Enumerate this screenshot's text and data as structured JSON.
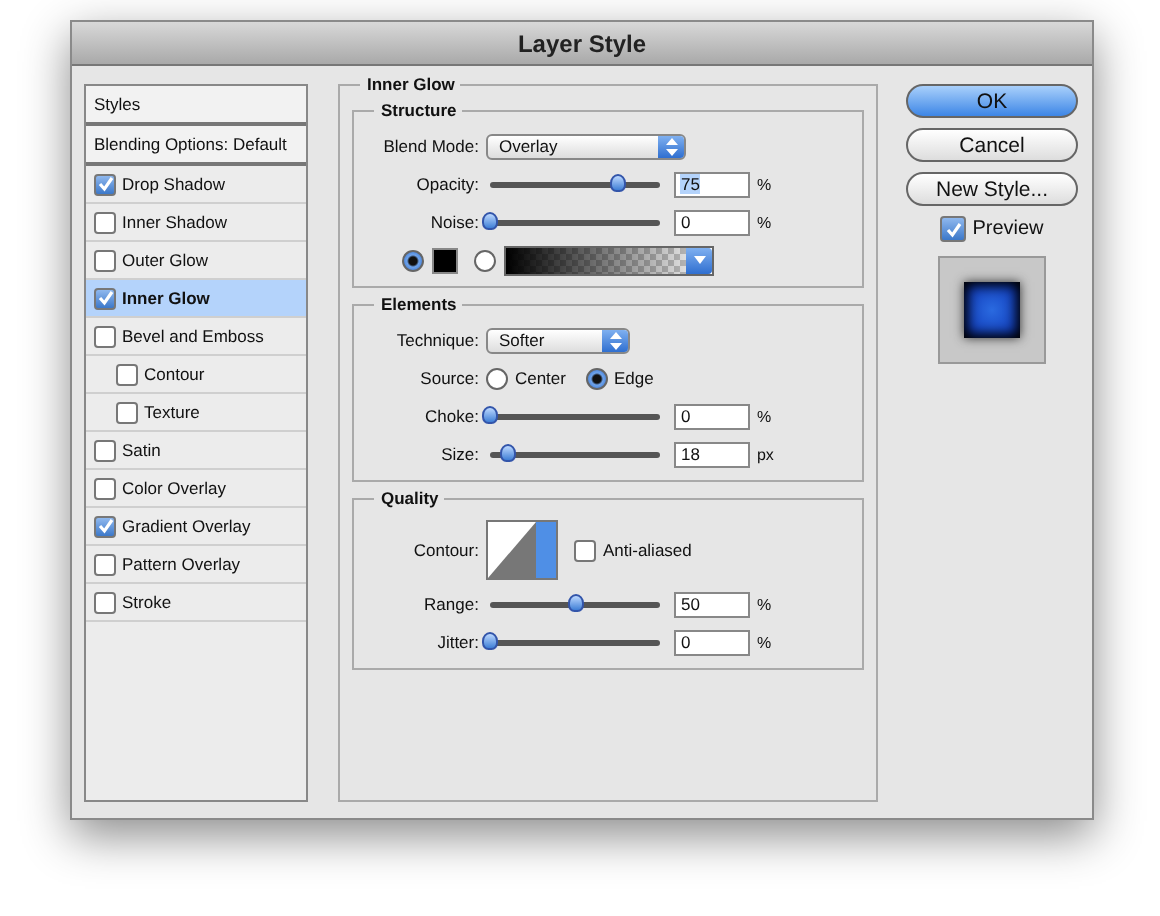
{
  "window": {
    "title": "Layer Style"
  },
  "sidebar": {
    "items": [
      {
        "label": "Styles",
        "kind": "header",
        "selected": false
      },
      {
        "label": "Blending Options: Default",
        "kind": "header",
        "selected": false
      },
      {
        "label": "Drop Shadow",
        "kind": "check",
        "checked": true,
        "selected": false
      },
      {
        "label": "Inner Shadow",
        "kind": "check",
        "checked": false,
        "selected": false
      },
      {
        "label": "Outer Glow",
        "kind": "check",
        "checked": false,
        "selected": false
      },
      {
        "label": "Inner Glow",
        "kind": "check",
        "checked": true,
        "selected": true
      },
      {
        "label": "Bevel and Emboss",
        "kind": "check",
        "checked": false,
        "selected": false,
        "children": [
          {
            "label": "Contour",
            "kind": "check",
            "checked": false,
            "selected": false
          },
          {
            "label": "Texture",
            "kind": "check",
            "checked": false,
            "selected": false
          }
        ]
      },
      {
        "label": "Satin",
        "kind": "check",
        "checked": false,
        "selected": false
      },
      {
        "label": "Color Overlay",
        "kind": "check",
        "checked": false,
        "selected": false
      },
      {
        "label": "Gradient Overlay",
        "kind": "check",
        "checked": true,
        "selected": false
      },
      {
        "label": "Pattern Overlay",
        "kind": "check",
        "checked": false,
        "selected": false
      },
      {
        "label": "Stroke",
        "kind": "check",
        "checked": false,
        "selected": false
      }
    ]
  },
  "panel": {
    "title": "Inner Glow",
    "sections": [
      {
        "title": "Structure",
        "rows": [
          {
            "kind": "select",
            "label": "Blend Mode:",
            "value": "Overlay"
          },
          {
            "kind": "slider",
            "label": "Opacity:",
            "level": 0.75,
            "value": "75",
            "unit": "%",
            "focused": true
          },
          {
            "kind": "slider",
            "label": "Noise:",
            "level": 0,
            "value": "0",
            "unit": "%",
            "focused": false
          },
          {
            "kind": "fill",
            "options": [
              {
                "kind": "color",
                "selected": true
              },
              {
                "kind": "gradient",
                "selected": false
              }
            ]
          }
        ]
      },
      {
        "title": "Elements",
        "rows": [
          {
            "kind": "select",
            "label": "Technique:",
            "value": "Softer"
          },
          {
            "kind": "radio",
            "label": "Source:",
            "options": [
              {
                "label": "Center",
                "selected": false
              },
              {
                "label": "Edge",
                "selected": true
              }
            ]
          },
          {
            "kind": "slider",
            "label": "Choke:",
            "level": 0,
            "value": "0",
            "unit": "%",
            "focused": false
          },
          {
            "kind": "slider",
            "label": "Size:",
            "level": 0.1,
            "value": "18",
            "unit": "px",
            "focused": false
          }
        ]
      },
      {
        "title": "Quality",
        "rows": [
          {
            "kind": "contour",
            "label": "Contour:",
            "checkbox": {
              "label": "Anti-aliased",
              "checked": false
            }
          },
          {
            "kind": "slider",
            "label": "Range:",
            "level": 0.5,
            "value": "50",
            "unit": "%",
            "focused": false
          },
          {
            "kind": "slider",
            "label": "Jitter:",
            "level": 0,
            "value": "0",
            "unit": "%",
            "focused": false
          }
        ]
      }
    ]
  },
  "buttons": [
    {
      "label": "OK",
      "default": true
    },
    {
      "label": "Cancel",
      "default": false
    },
    {
      "label": "New Style...",
      "default": false
    }
  ],
  "preview": {
    "label": "Preview",
    "checked": true
  }
}
